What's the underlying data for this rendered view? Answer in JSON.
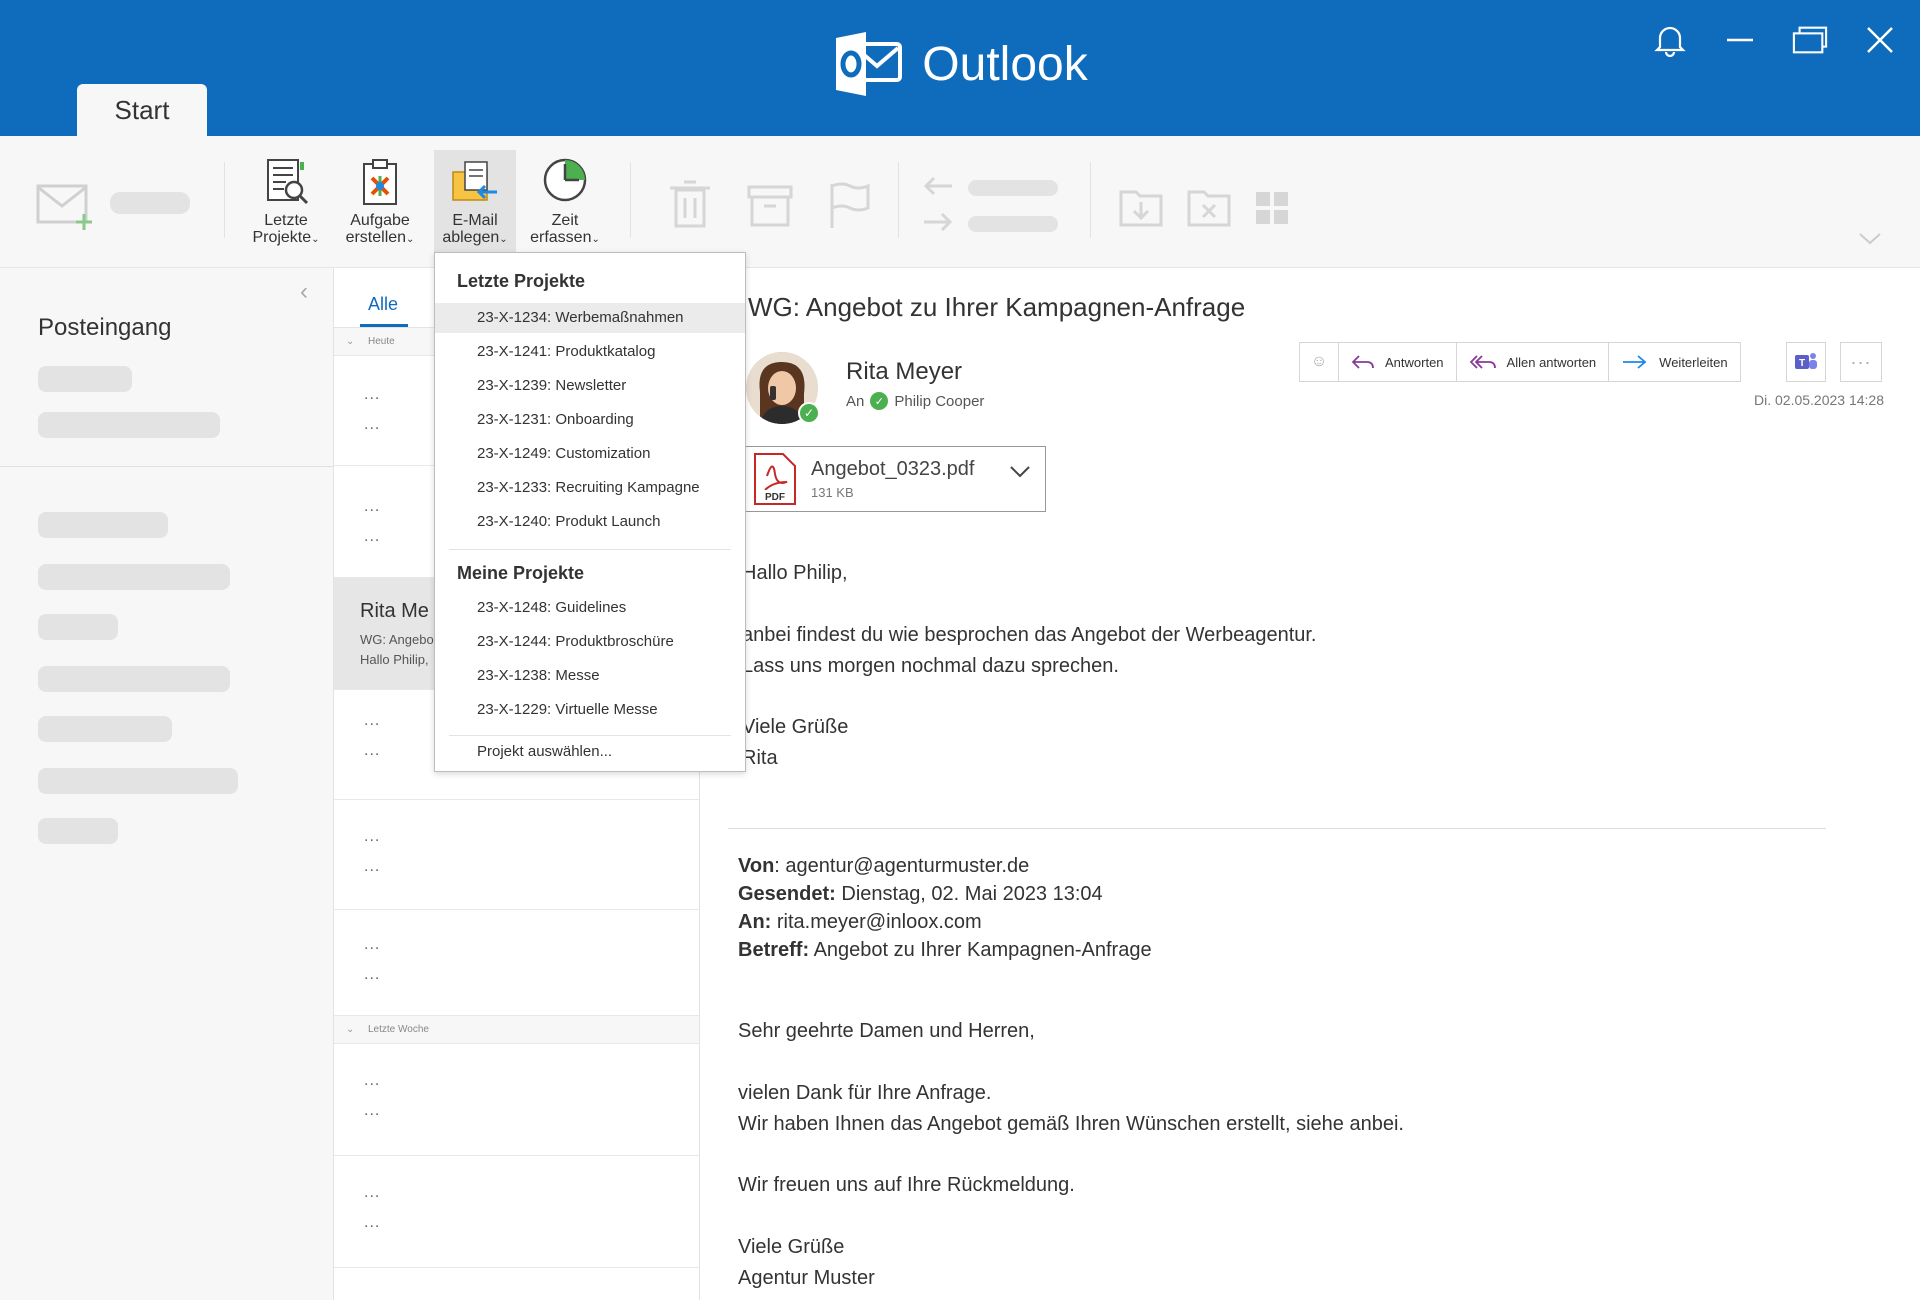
{
  "app": {
    "title": "Outlook",
    "brand_color": "#0f6cbd",
    "window_icons": [
      "bell-icon",
      "minimize-icon",
      "restore-icon",
      "close-icon"
    ]
  },
  "tabs": {
    "start": "Start"
  },
  "ribbon": {
    "recent_projects": {
      "line1": "Letzte",
      "line2": "Projekte"
    },
    "create_task": {
      "line1": "Aufgabe",
      "line2": "erstellen"
    },
    "file_email": {
      "line1": "E-Mail",
      "line2": "ablegen"
    },
    "track_time": {
      "line1": "Zeit",
      "line2": "erfassen"
    }
  },
  "nav": {
    "folder": "Posteingang"
  },
  "list": {
    "filter_tab": "Alle",
    "group_today": "Heute",
    "group_last_week": "Letzte Woche",
    "placeholder": "...",
    "selected": {
      "sender": "Rita Me",
      "subject": "WG: Angebo",
      "preview": "Hallo Philip,"
    }
  },
  "dropdown": {
    "recent_header": "Letzte Projekte",
    "recent": [
      "23-X-1234: Werbemaßnahmen",
      "23-X-1241: Produktkatalog",
      "23-X-1239: Newsletter",
      "23-X-1231: Onboarding",
      "23-X-1249: Customization",
      "23-X-1233: Recruiting Kampagne",
      "23-X-1240: Produkt Launch"
    ],
    "mine_header": "Meine Projekte",
    "mine": [
      "23-X-1248: Guidelines",
      "23-X-1244: Produktbroschüre",
      "23-X-1238: Messe",
      "23-X-1229: Virtuelle Messe"
    ],
    "choose": "Projekt auswählen..."
  },
  "mail": {
    "subject": "WG: Angebot zu Ihrer Kampagnen-Anfrage",
    "from": "Rita Meyer",
    "to_label": "An",
    "to": "Philip Cooper",
    "datetime": "Di. 02.05.2023 14:28",
    "actions": {
      "reply": "Antworten",
      "reply_all": "Allen antworten",
      "forward": "Weiterleiten"
    },
    "attachment": {
      "name": "Angebot_0323.pdf",
      "size": "131 KB",
      "badge": "PDF"
    },
    "greeting": "Hallo Philip,",
    "para1": "anbei findest du wie besprochen das Angebot der Werbeagentur.",
    "para2": "Lass uns morgen nochmal dazu sprechen.",
    "closing": "Viele Grüße",
    "signature": "Rita",
    "fwd": {
      "from_label": "Von",
      "from": "agentur@agenturmuster.de",
      "sent_label": "Gesendet:",
      "sent": "Dienstag, 02. Mai 2023 13:04",
      "to_label": "An:",
      "to": "rita.meyer@inloox.com",
      "subject_label": "Betreff:",
      "subject": "Angebot zu Ihrer Kampagnen-Anfrage",
      "salutation": "Sehr geehrte Damen und Herren,",
      "line1": "vielen Dank für Ihre Anfrage.",
      "line2": "Wir haben Ihnen das Angebot gemäß Ihren Wünschen erstellt, siehe anbei.",
      "line3": "Wir freuen uns auf Ihre Rückmeldung.",
      "closing": "Viele Grüße",
      "signature": "Agentur Muster"
    }
  }
}
